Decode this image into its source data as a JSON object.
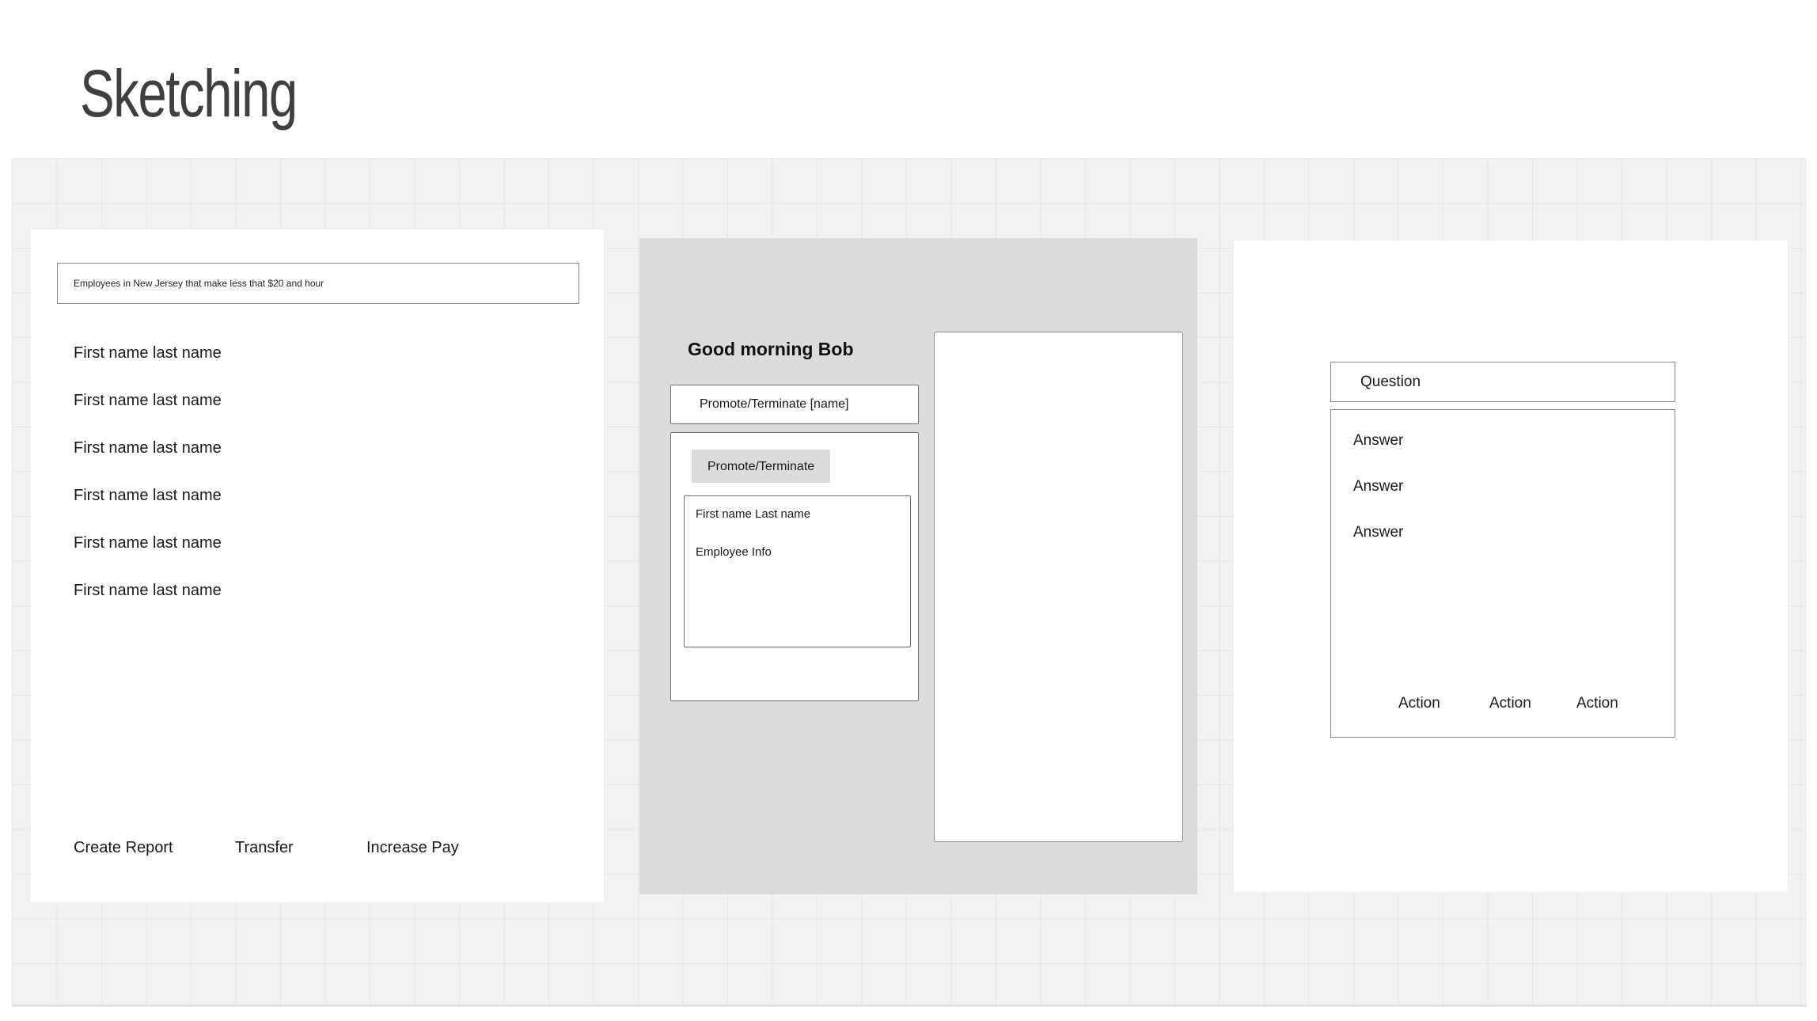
{
  "slide": {
    "title": "Sketching"
  },
  "frame1": {
    "query": "Employees in New Jersey that make less that $20 and hour",
    "employees": [
      "First name last name",
      "First name last name",
      "First name last name",
      "First name last name",
      "First name last name",
      "First name last name"
    ],
    "actions": [
      "Create Report",
      "Transfer",
      "Increase Pay"
    ]
  },
  "frame2": {
    "greeting": "Good morning Bob",
    "field_value": "Promote/Terminate [name]",
    "tab_label": "Promote/Terminate",
    "card_name": "First name Last name",
    "card_info": "Employee Info"
  },
  "frame3": {
    "question": "Question",
    "answers": [
      "Answer",
      "Answer",
      "Answer"
    ],
    "actions": [
      "Action",
      "Action",
      "Action"
    ]
  },
  "colors": {
    "canvas_bg": "#f2f2f2",
    "frame2_bg": "#dddcdb",
    "tab_bg": "#dcdcdc",
    "title_text": "#3f3f3f"
  }
}
